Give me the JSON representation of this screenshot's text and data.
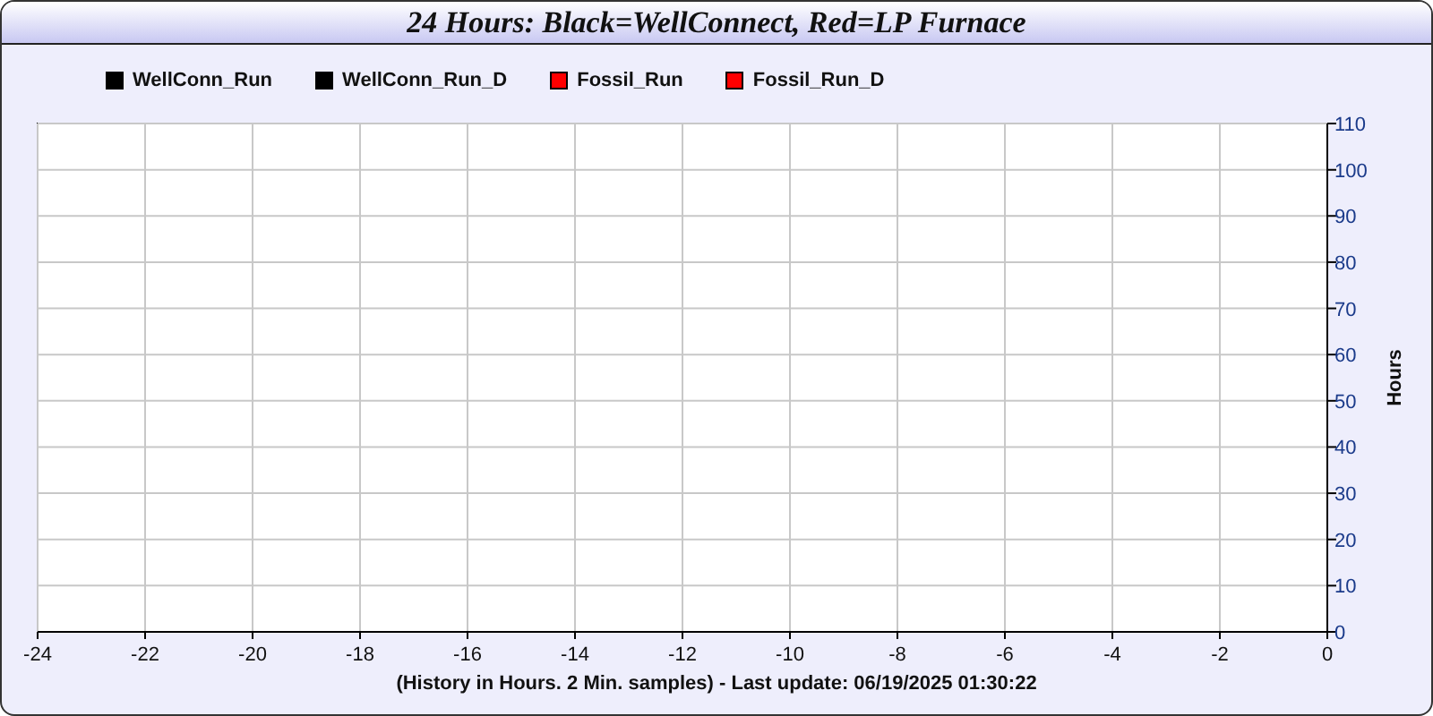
{
  "title": "24 Hours: Black=WellConnect, Red=LP Furnace",
  "chart_data": {
    "type": "line",
    "xlabel": "(History in Hours. 2 Min. samples) - Last update: 06/19/2025 01:30:22",
    "ylabel": "Hours",
    "grid": true,
    "series": [
      {
        "name": "WellConn_Run",
        "color": "#000000",
        "values": [
          null,
          null,
          null,
          null,
          null,
          null,
          null,
          null,
          null,
          null,
          null,
          null,
          null
        ]
      },
      {
        "name": "WellConn_Run_D",
        "color": "#000000",
        "values": [
          null,
          null,
          null,
          null,
          null,
          null,
          null,
          null,
          null,
          null,
          null,
          null,
          null
        ]
      },
      {
        "name": "Fossil_Run",
        "color": "#ff0000",
        "values": [
          null,
          null,
          null,
          null,
          null,
          null,
          null,
          null,
          null,
          null,
          null,
          null,
          null
        ]
      },
      {
        "name": "Fossil_Run_D",
        "color": "#ff0000",
        "values": [
          null,
          null,
          null,
          null,
          null,
          null,
          null,
          null,
          null,
          null,
          null,
          null,
          null
        ]
      }
    ],
    "x": [
      -24,
      -22,
      -20,
      -18,
      -16,
      -14,
      -12,
      -10,
      -8,
      -6,
      -4,
      -2,
      0
    ],
    "ylim": [
      0,
      110
    ],
    "yticks": [
      0,
      10,
      20,
      30,
      40,
      50,
      60,
      70,
      80,
      90,
      100,
      110
    ]
  }
}
